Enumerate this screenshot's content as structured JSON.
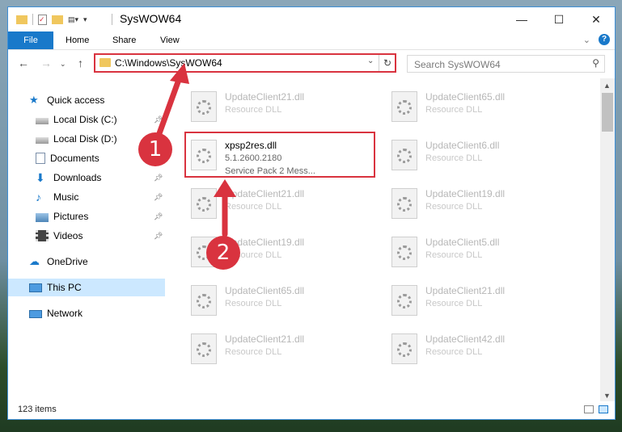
{
  "window": {
    "title": "SysWOW64"
  },
  "ribbon": {
    "tabs": [
      "File",
      "Home",
      "Share",
      "View"
    ]
  },
  "address": {
    "path": "C:\\Windows\\SysWOW64"
  },
  "search": {
    "placeholder": "Search SysWOW64"
  },
  "sidebar": {
    "items": [
      {
        "label": "Quick access",
        "icon": "star-icon",
        "pinned": false
      },
      {
        "label": "Local Disk (C:)",
        "icon": "drive-icon",
        "pinned": true
      },
      {
        "label": "Local Disk (D:)",
        "icon": "drive-icon",
        "pinned": false
      },
      {
        "label": "Documents",
        "icon": "document-icon",
        "pinned": true
      },
      {
        "label": "Downloads",
        "icon": "download-icon",
        "pinned": true
      },
      {
        "label": "Music",
        "icon": "music-icon",
        "pinned": true
      },
      {
        "label": "Pictures",
        "icon": "picture-icon",
        "pinned": true
      },
      {
        "label": "Videos",
        "icon": "video-icon",
        "pinned": true
      },
      {
        "label": "OneDrive",
        "icon": "cloud-icon",
        "pinned": false
      },
      {
        "label": "This PC",
        "icon": "computer-icon",
        "pinned": false
      },
      {
        "label": "Network",
        "icon": "network-icon",
        "pinned": false
      }
    ]
  },
  "files": [
    {
      "name": "UpdateClient21.dll",
      "sub": "Resource DLL"
    },
    {
      "name": "UpdateClient65.dll",
      "sub": "Resource DLL"
    },
    {
      "name": "xpsp2res.dll",
      "sub": "5.1.2600.2180",
      "desc": "Service Pack 2 Mess..."
    },
    {
      "name": "UpdateClient6.dll",
      "sub": "Resource DLL"
    },
    {
      "name": "UpdateClient21.dll",
      "sub": "Resource DLL"
    },
    {
      "name": "UpdateClient19.dll",
      "sub": "Resource DLL"
    },
    {
      "name": "UpdateClient19.dll",
      "sub": "Resource DLL"
    },
    {
      "name": "UpdateClient5.dll",
      "sub": "Resource DLL"
    },
    {
      "name": "UpdateClient65.dll",
      "sub": "Resource DLL"
    },
    {
      "name": "UpdateClient21.dll",
      "sub": "Resource DLL"
    },
    {
      "name": "UpdateClient21.dll",
      "sub": "Resource DLL"
    },
    {
      "name": "UpdateClient42.dll",
      "sub": "Resource DLL"
    }
  ],
  "status": {
    "count": "123 items"
  },
  "annotations": {
    "step1": "1",
    "step2": "2"
  },
  "colors": {
    "accent": "#1979ca",
    "highlight": "#d9333f",
    "selected": "#cce8ff"
  }
}
